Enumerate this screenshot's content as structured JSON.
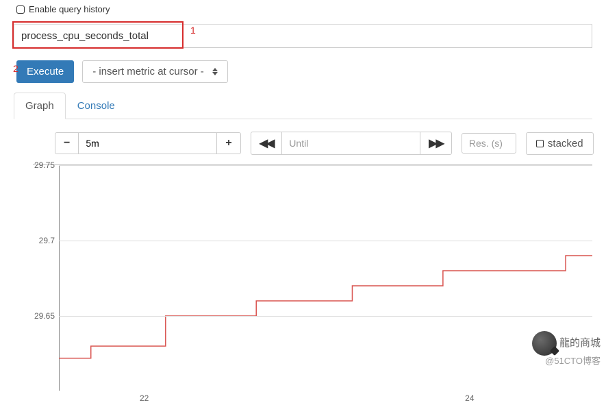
{
  "header": {
    "enable_history_label": "Enable query history"
  },
  "query": {
    "value": "process_cpu_seconds_total"
  },
  "annotations": {
    "label1": "1",
    "label2": "2"
  },
  "actions": {
    "execute_label": "Execute",
    "metric_dropdown_label": "- insert metric at cursor -"
  },
  "tabs": {
    "graph": "Graph",
    "console": "Console"
  },
  "controls": {
    "minus": "−",
    "plus": "+",
    "range_value": "5m",
    "until_label": "Until",
    "back": "◀◀",
    "forward": "▶▶",
    "res_placeholder": "Res. (s)",
    "stacked_label": "stacked"
  },
  "chart_data": {
    "type": "line",
    "title": "",
    "xlabel": "",
    "ylabel": "",
    "ylim": [
      29.6,
      29.75
    ],
    "y_ticks": [
      29.75,
      29.7,
      29.65
    ],
    "x_ticks": [
      "22",
      "24"
    ],
    "series": [
      {
        "name": "process_cpu_seconds_total",
        "color": "#d9534f",
        "points": [
          {
            "x": 0.0,
            "y": 29.622
          },
          {
            "x": 0.06,
            "y": 29.622
          },
          {
            "x": 0.06,
            "y": 29.63
          },
          {
            "x": 0.2,
            "y": 29.63
          },
          {
            "x": 0.2,
            "y": 29.65
          },
          {
            "x": 0.37,
            "y": 29.65
          },
          {
            "x": 0.37,
            "y": 29.66
          },
          {
            "x": 0.55,
            "y": 29.66
          },
          {
            "x": 0.55,
            "y": 29.67
          },
          {
            "x": 0.72,
            "y": 29.67
          },
          {
            "x": 0.72,
            "y": 29.68
          },
          {
            "x": 0.95,
            "y": 29.68
          },
          {
            "x": 0.95,
            "y": 29.69
          },
          {
            "x": 1.0,
            "y": 29.69
          }
        ]
      }
    ]
  },
  "watermark": {
    "line1": "龍的商城",
    "line2": "@51CTO博客"
  }
}
